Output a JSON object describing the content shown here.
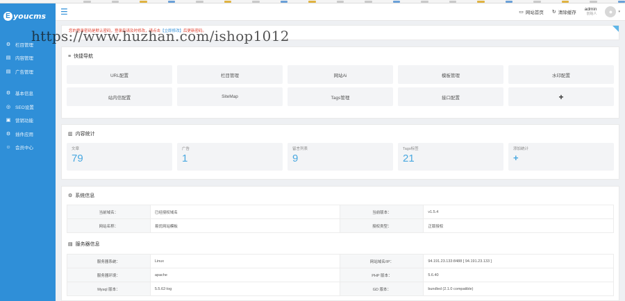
{
  "watermark": "https://www.huzhan.com/ishop1012",
  "sidebar": {
    "logo_mark": "E",
    "logo_text": "youcms",
    "groups": [
      [
        {
          "label": "栏目管理",
          "icon": "gear-icon"
        },
        {
          "label": "内容管理",
          "icon": "document-icon"
        },
        {
          "label": "广告管理",
          "icon": "document-icon"
        }
      ],
      [
        {
          "label": "基本信息",
          "icon": "gear-icon"
        },
        {
          "label": "SEO设置",
          "icon": "target-icon"
        },
        {
          "label": "营销功能",
          "icon": "megaphone-icon"
        },
        {
          "label": "插件应用",
          "icon": "gear-icon"
        },
        {
          "label": "会员中心",
          "icon": "user-icon"
        }
      ]
    ]
  },
  "topbar": {
    "home_label": "网站首页",
    "clear_cache_label": "清除缓存",
    "user_name": "admin",
    "user_role": "创始人"
  },
  "notice": {
    "prefix": "您的登录密码是默认密码，登录后请及时修改",
    "mid": "，请点击",
    "link": "【立即修改】",
    "suffix": "后更新密码。"
  },
  "quick_nav": {
    "title": "快捷导航",
    "items": [
      "URL配置",
      "栏目管理",
      "网站Ai",
      "模板管理",
      "水印配置",
      "站内信配置",
      "SiteMap",
      "Tags管理",
      "接口配置",
      "+"
    ]
  },
  "stats": {
    "title": "内容统计",
    "items": [
      {
        "label": "文章",
        "value": "79"
      },
      {
        "label": "广告",
        "value": "1"
      },
      {
        "label": "留言列表",
        "value": "9"
      },
      {
        "label": "Tags标签",
        "value": "21"
      },
      {
        "label": "添加统计",
        "value": "+"
      }
    ]
  },
  "system_info": {
    "title": "系统信息",
    "rows": [
      [
        "当前域名：",
        "已经授权域名",
        "当前版本：",
        "v1.5.4"
      ],
      [
        "网站名称：",
        "易优网站模板",
        "授权类型：",
        "正版授权"
      ]
    ]
  },
  "server_info": {
    "title": "服务器信息",
    "rows": [
      [
        "服务器系统：",
        "Linux",
        "网站域名/IP：",
        "94.191.23.133:8488 [ 94.191.23.133 ]"
      ],
      [
        "服务器环境：",
        "apache",
        "PHP 版本：",
        "5.6.40"
      ],
      [
        "Mysql 版本：",
        "5.5.62-log",
        "GD 版本：",
        "bundled (2.1.0 compatible)"
      ]
    ]
  },
  "colors": {
    "sidebar": "#2f8fd8",
    "accent": "#49a8e0",
    "notice_red": "#e0402f"
  }
}
